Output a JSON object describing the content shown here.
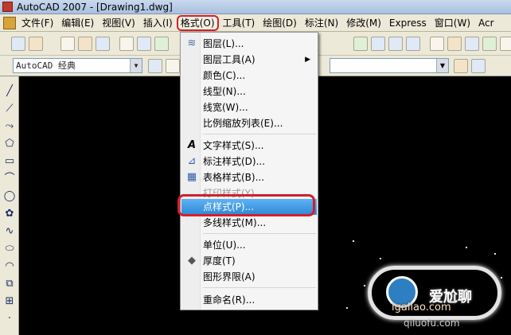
{
  "window": {
    "title": "AutoCAD 2007 - [Drawing1.dwg]"
  },
  "menubar": {
    "items": [
      "文件(F)",
      "编辑(E)",
      "视图(V)",
      "插入(I)",
      "格式(O)",
      "工具(T)",
      "绘图(D)",
      "标注(N)",
      "修改(M)",
      "Express",
      "窗口(W)",
      "Acr"
    ]
  },
  "toolbar": {
    "workspace_value": "AutoCAD 经典"
  },
  "format_menu": {
    "items": [
      {
        "label": "图层(L)...",
        "icon": "layers-icon"
      },
      {
        "label": "图层工具(A)",
        "icon": "",
        "submenu": "▶"
      },
      {
        "label": "颜色(C)...",
        "icon": ""
      },
      {
        "label": "线型(N)...",
        "icon": ""
      },
      {
        "label": "线宽(W)...",
        "icon": ""
      },
      {
        "label": "比例缩放列表(E)...",
        "icon": ""
      },
      {
        "label": "文字样式(S)...",
        "icon": "text-style-icon"
      },
      {
        "label": "标注样式(D)...",
        "icon": "dimension-style-icon"
      },
      {
        "label": "表格样式(B)...",
        "icon": "table-style-icon"
      },
      {
        "label": "打印样式(Y)...",
        "icon": "",
        "disabled": true
      },
      {
        "label": "点样式(P)...",
        "icon": "",
        "highlighted": true
      },
      {
        "label": "多线样式(M)...",
        "icon": ""
      },
      {
        "label": "单位(U)...",
        "icon": ""
      },
      {
        "label": "厚度(T)",
        "icon": "thickness-icon"
      },
      {
        "label": "图形界限(A)",
        "icon": ""
      },
      {
        "label": "重命名(R)...",
        "icon": ""
      }
    ]
  },
  "watermark": {
    "text": "爱尬聊",
    "url": "igaliao.com",
    "url2": "qiluofu.com"
  },
  "colors": {
    "highlight": "#2e89d6",
    "annotation_ring": "#d51f2a",
    "canvas": "#000000"
  }
}
